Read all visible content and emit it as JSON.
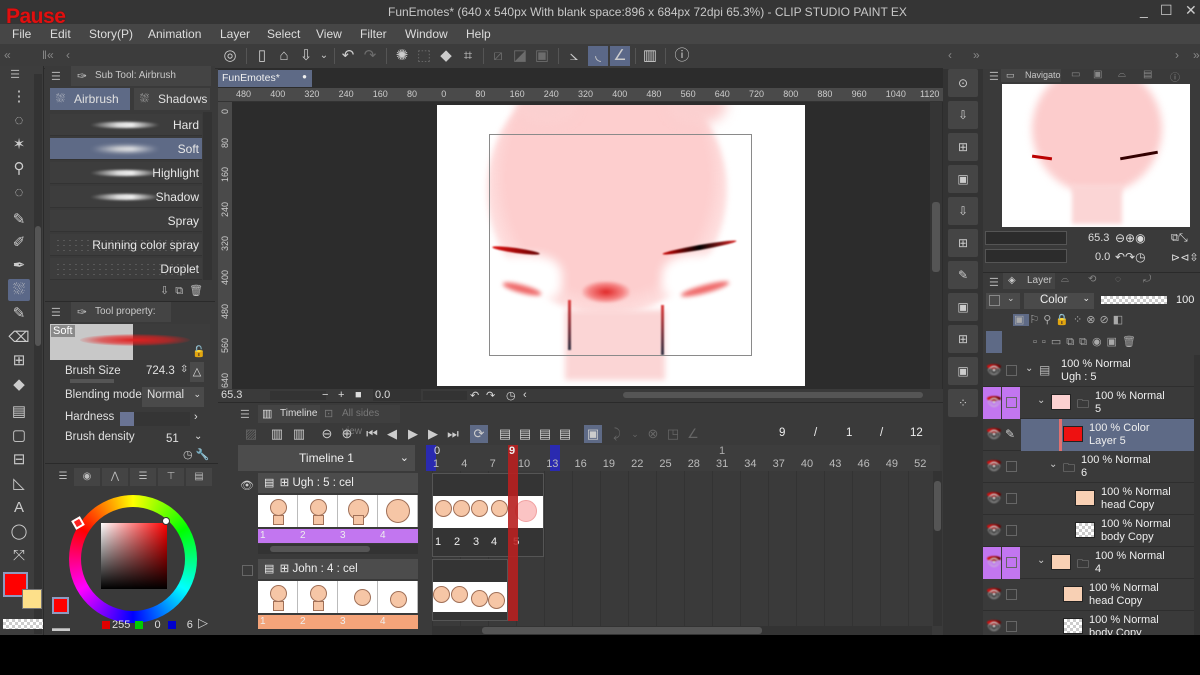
{
  "overlay": {
    "pause_label": "Pause"
  },
  "titlebar": {
    "title": "FunEmotes* (640 x 540px With blank space:896 x 684px 72dpi 65.3%)  - CLIP STUDIO PAINT EX",
    "minimize": "_",
    "maximize": "☐",
    "close": "✕"
  },
  "menu": [
    "File",
    "Edit",
    "Story(P)",
    "Animation",
    "Layer",
    "Select",
    "View",
    "Filter",
    "Window",
    "Help"
  ],
  "toolbar": {
    "icons": [
      "clip-studio-icon",
      "new-file-icon",
      "open-file-icon",
      "save-icon",
      "dropdown-icon",
      "undo-icon",
      "redo-icon",
      "deselect-icon",
      "select-all-icon",
      "fill-icon",
      "transform-icon",
      "clear-outside-icon",
      "fill-selection-icon",
      "select-layer-icon",
      "snap-ruler-icon",
      "snap-special-ruler-icon",
      "snap-grid-icon",
      "smartphone-icon",
      "help-icon"
    ]
  },
  "subtool": {
    "panel_title": "Sub Tool: Airbrush",
    "tabs": [
      {
        "label": "Airbrush",
        "active": true
      },
      {
        "label": "Shadows",
        "active": false
      }
    ],
    "brushes": [
      {
        "name": "Hard",
        "active": false,
        "style": "stroke"
      },
      {
        "name": "Soft",
        "active": true,
        "style": "stroke"
      },
      {
        "name": "Highlight",
        "active": false,
        "style": "stroke"
      },
      {
        "name": "Shadow",
        "active": false,
        "style": "stroke"
      },
      {
        "name": "Spray",
        "active": false,
        "style": "none"
      },
      {
        "name": "Running color spray",
        "active": false,
        "style": "dots"
      },
      {
        "name": "Droplet",
        "active": false,
        "style": "dots"
      }
    ]
  },
  "tool_property": {
    "panel_title": "Tool property: Soft",
    "preview_label": "Soft",
    "brush_size_label": "Brush Size",
    "brush_size_value": "724.3",
    "blending_mode_label": "Blending mode",
    "blending_mode_value": "Normal",
    "hardness_label": "Hardness",
    "hardness_level": 1,
    "hardness_levels": 5,
    "brush_density_label": "Brush density",
    "brush_density_value": "51"
  },
  "color": {
    "main_color": "#ff0000",
    "sub_color": "#fde08a",
    "r_value": "255",
    "g_value": "0",
    "b_value": "6"
  },
  "document": {
    "tab_label": "FunEmotes*",
    "hruler_ticks": [
      "480",
      "400",
      "320",
      "240",
      "160",
      "80",
      "0",
      "80",
      "160",
      "240",
      "320",
      "400",
      "480",
      "560",
      "640",
      "720",
      "800",
      "880",
      "960",
      "1040",
      "1120"
    ],
    "vruler_ticks": [
      "0",
      "80",
      "160",
      "240",
      "320",
      "400",
      "480",
      "560",
      "640"
    ],
    "zoom_value": "65.3",
    "rotation_value": "0.0"
  },
  "timeline": {
    "tab_label": "Timeline",
    "tab2_label": "All sides view",
    "name": "Timeline 1",
    "current_frame": "9",
    "sep1": "/",
    "start_frame": "1",
    "sep2": "/",
    "end_frame": "12",
    "playhead_label": "9",
    "marker_start_label": "0",
    "marker_31_label": "1",
    "frame_numbers": [
      "1",
      "4",
      "7",
      "10",
      "13",
      "16",
      "19",
      "22",
      "25",
      "28",
      "31",
      "34",
      "37",
      "40",
      "43",
      "46",
      "49",
      "52"
    ],
    "tracks": [
      {
        "name": "Ugh : 5 : cel",
        "visible": true,
        "color": "#c276f0",
        "cels": [
          "1",
          "2",
          "3",
          "4"
        ],
        "seq": [
          "1",
          "2",
          "3",
          "4",
          "5"
        ]
      },
      {
        "name": "John : 4 : cel",
        "visible": false,
        "color": "#f4a47a",
        "cels": [
          "1",
          "2",
          "3",
          "4"
        ],
        "seq": []
      }
    ]
  },
  "navigator": {
    "tab_label": "Navigato",
    "zoom": "65.3",
    "rotation": "0.0"
  },
  "layer": {
    "tab_label": "Layer",
    "blend_mode": "Color",
    "opacity": "100",
    "rows": [
      {
        "line1": "100 % Normal",
        "line2": "Ugh : 5",
        "indent": 0,
        "type": "anim-folder",
        "chev": true,
        "selected": false,
        "highlight": false,
        "thumb": "none"
      },
      {
        "line1": "100 % Normal",
        "line2": "5",
        "indent": 1,
        "type": "folder",
        "chev": true,
        "selected": false,
        "highlight": true,
        "thumb": "pink"
      },
      {
        "line1": "100 % Color",
        "line2": "Layer 5",
        "indent": 2,
        "type": "layer",
        "chev": false,
        "selected": true,
        "highlight": false,
        "thumb": "red"
      },
      {
        "line1": "100 % Normal",
        "line2": "6",
        "indent": 2,
        "type": "folder",
        "chev": true,
        "selected": false,
        "highlight": false,
        "thumb": "none"
      },
      {
        "line1": "100 % Normal",
        "line2": "head Copy",
        "indent": 3,
        "type": "layer",
        "chev": false,
        "selected": false,
        "highlight": false,
        "thumb": "skin"
      },
      {
        "line1": "100 % Normal",
        "line2": "body Copy",
        "indent": 3,
        "type": "layer",
        "chev": false,
        "selected": false,
        "highlight": false,
        "thumb": "checker"
      },
      {
        "line1": "100 % Normal",
        "line2": "4",
        "indent": 1,
        "type": "folder",
        "chev": true,
        "selected": false,
        "highlight": true,
        "thumb": "skin"
      },
      {
        "line1": "100 % Normal",
        "line2": "head Copy",
        "indent": 2,
        "type": "layer",
        "chev": false,
        "selected": false,
        "highlight": false,
        "thumb": "skin"
      },
      {
        "line1": "100 % Normal",
        "line2": "body Copy",
        "indent": 2,
        "type": "layer",
        "chev": false,
        "selected": false,
        "highlight": false,
        "thumb": "checker"
      }
    ]
  }
}
